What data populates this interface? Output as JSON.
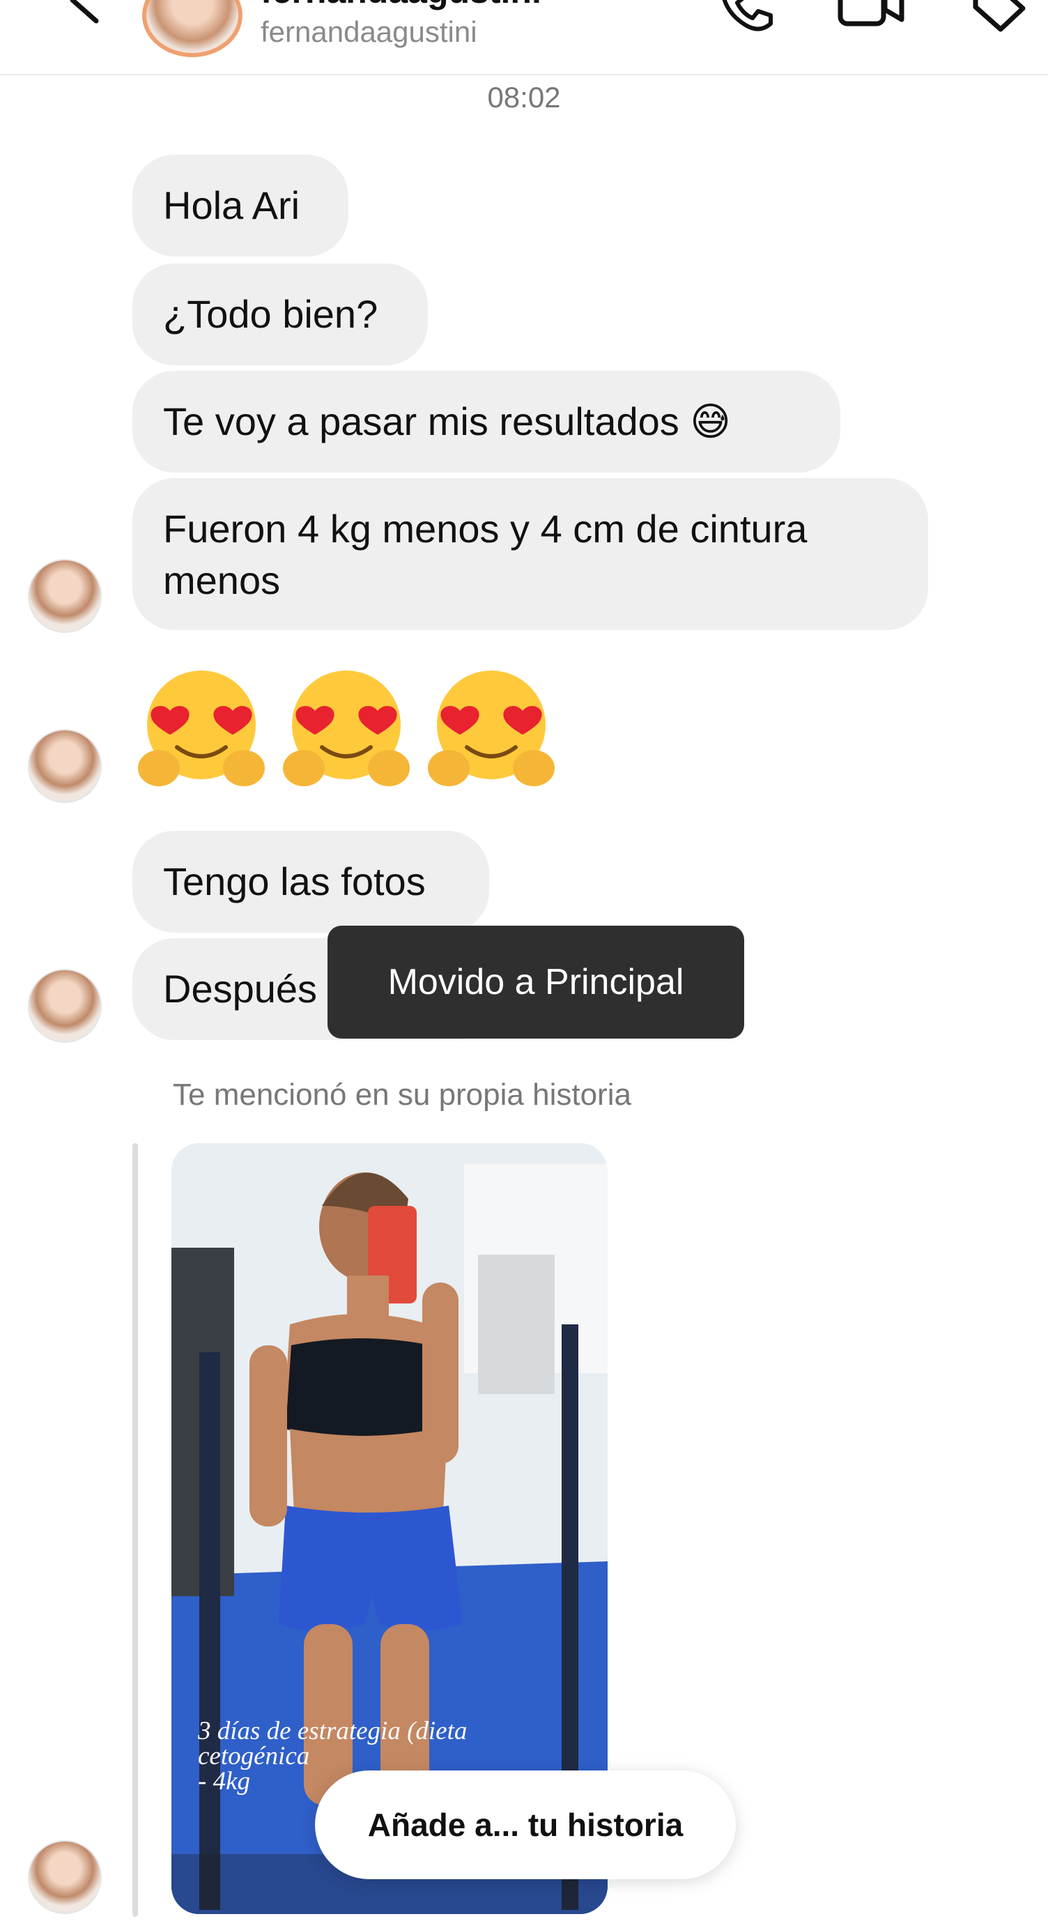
{
  "header": {
    "name": "fernandaagustini",
    "username": "fernandaagustini",
    "icons": [
      "back-icon",
      "phone-icon",
      "video-call-icon",
      "tag-icon"
    ]
  },
  "timestamp": "08:02",
  "messages": [
    {
      "text": "Hola Ari"
    },
    {
      "text": "¿Todo bien?"
    },
    {
      "text": "Te voy a pasar mis resultados 😅"
    },
    {
      "text": "Fueron 4 kg menos y 4 cm de cintura menos"
    },
    {
      "emoji": [
        "hugging-heart-eyes",
        "hugging-heart-eyes",
        "hugging-heart-eyes"
      ]
    },
    {
      "text": "Tengo las fotos"
    },
    {
      "text": "Después"
    }
  ],
  "toast": "Movido a Principal",
  "story": {
    "note": "Te mencionó en su propia historia",
    "caption": "3 días de estrategia (dieta\ncetogénica\n- 4kg",
    "add_label": "Añade a... tu historia"
  },
  "colors": {
    "bubble": "#efefef",
    "toast": "#262626",
    "gym_floor": "#2f5fc9"
  }
}
